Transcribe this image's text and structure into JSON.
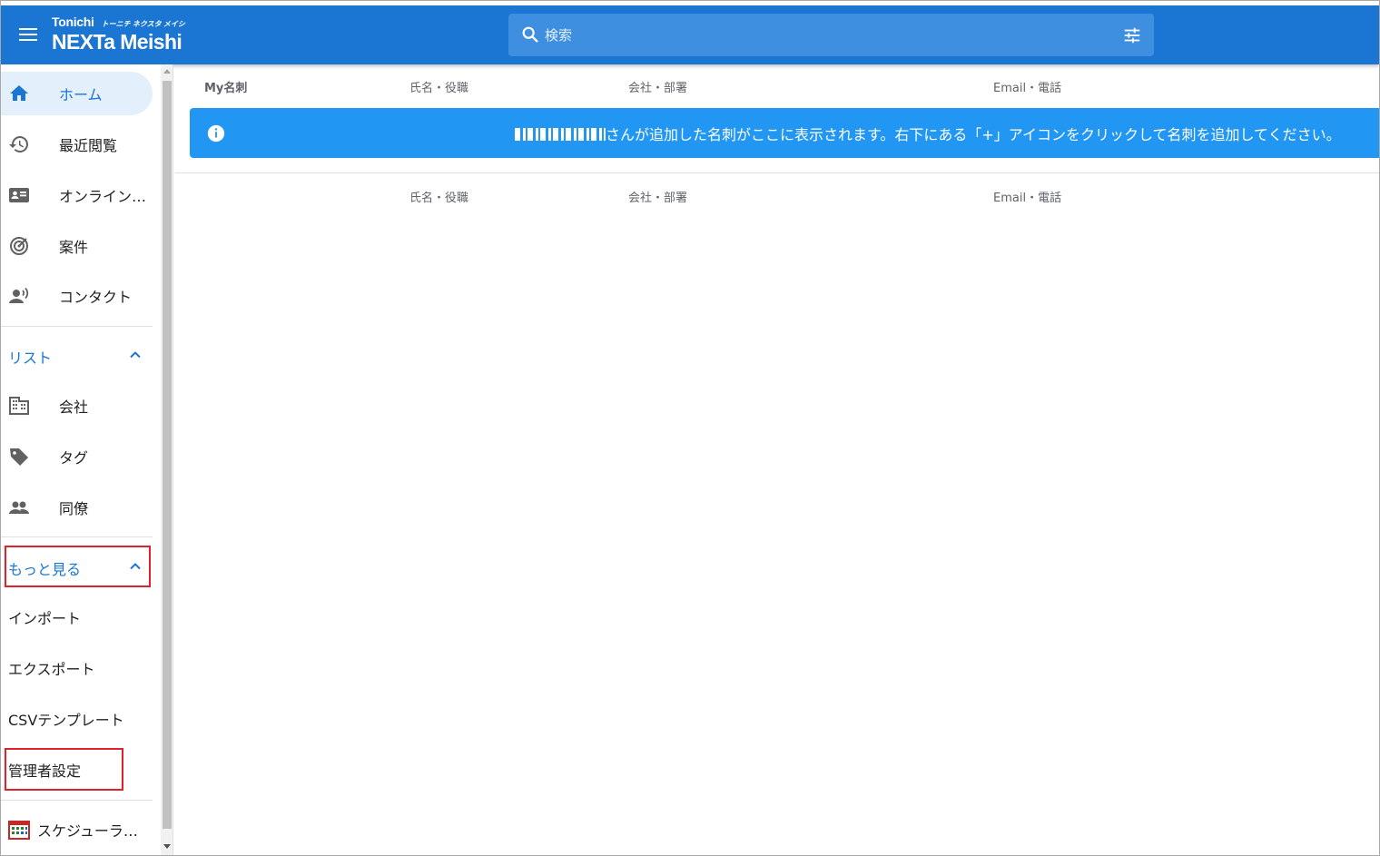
{
  "header": {
    "brand_small": "Tonichi",
    "brand_kana": "トーニチ ネクスタ メイシ",
    "brand_big": "NEXTa Meishi",
    "search_placeholder": "検索"
  },
  "sidebar": {
    "items": [
      {
        "label": "ホーム",
        "icon": "home-icon",
        "active": true
      },
      {
        "label": "最近閲覧",
        "icon": "history-icon"
      },
      {
        "label": "オンライン…",
        "icon": "contact-card-icon"
      },
      {
        "label": "案件",
        "icon": "target-icon"
      },
      {
        "label": "コンタクト",
        "icon": "contact-speaker-icon"
      }
    ],
    "list_section": {
      "label": "リスト",
      "items": [
        {
          "label": "会社",
          "icon": "building-icon"
        },
        {
          "label": "タグ",
          "icon": "tag-icon"
        },
        {
          "label": "同僚",
          "icon": "people-icon"
        }
      ]
    },
    "more_section": {
      "label": "もっと見る",
      "items": [
        {
          "label": "インポート"
        },
        {
          "label": "エクスポート"
        },
        {
          "label": "CSVテンプレート"
        },
        {
          "label": "管理者設定"
        }
      ]
    },
    "scheduler": {
      "label": "スケジューラ…",
      "icon": "calendar-icon"
    }
  },
  "main": {
    "top_headers": {
      "my_card": "My名刺",
      "name_title": "氏名・役職",
      "company_dept": "会社・部署",
      "email_phone": "Email・電話"
    },
    "info_message": "さんが追加した名刺がここに表示されます。右下にある「+」アイコンをクリックして名刺を追加してください。",
    "bottom_headers": {
      "name_title": "氏名・役職",
      "company_dept": "会社・部署",
      "email_phone": "Email・電話"
    }
  },
  "colors": {
    "appbar": "#1a76d2",
    "banner": "#2196f3",
    "highlight_box": "#e0202a"
  }
}
